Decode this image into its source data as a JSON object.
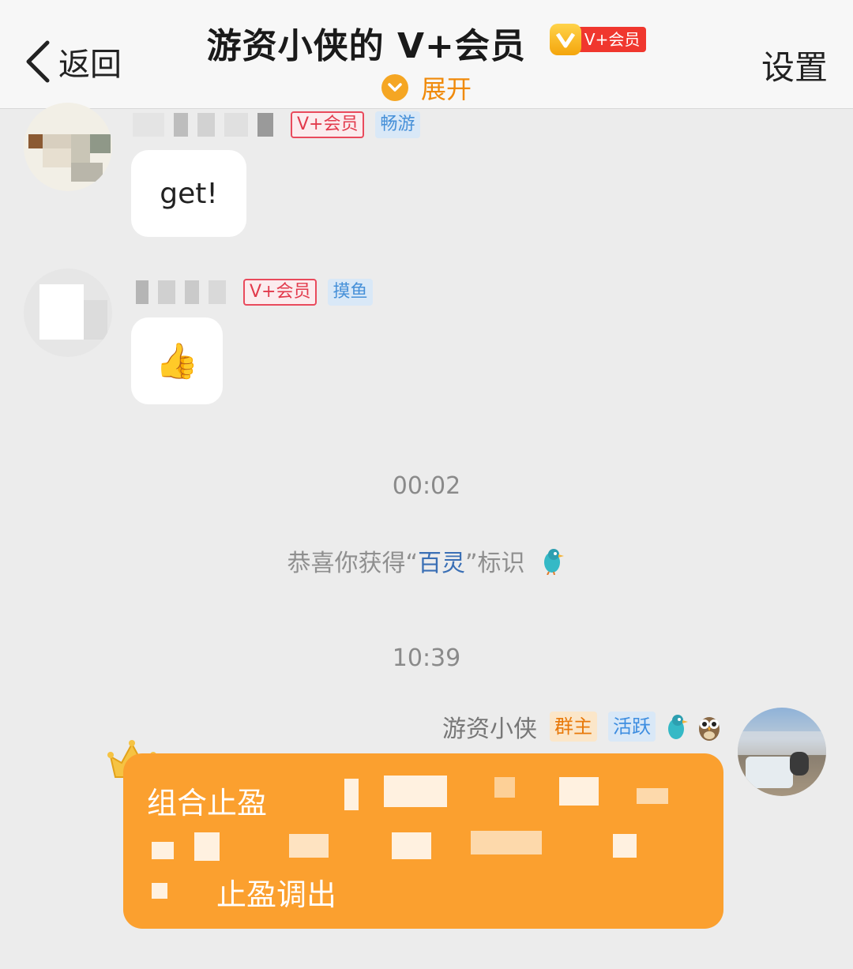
{
  "header": {
    "back_label": "返回",
    "title": "游资小侠的 V+会员",
    "vip_badge": "V+会员",
    "expand_label": "展开",
    "settings_label": "设置"
  },
  "messages": [
    {
      "tag_vip": "V+会员",
      "tag_level": "畅游",
      "text": "get!"
    },
    {
      "tag_vip": "V+会员",
      "tag_level": "摸鱼",
      "emoji": "👍"
    }
  ],
  "timestamps": [
    "00:02",
    "10:39"
  ],
  "system_message": {
    "prefix": "恭喜你获得“",
    "highlight": "百灵",
    "suffix": "”标识"
  },
  "my_message": {
    "name": "游资小侠",
    "tag_owner": "群主",
    "tag_active": "活跃",
    "line1": "组合止盈",
    "line3": "止盈调出"
  },
  "colors": {
    "accent_orange": "#fba02f",
    "tag_blue": "#4690d8",
    "tag_red": "#e23a4c"
  }
}
